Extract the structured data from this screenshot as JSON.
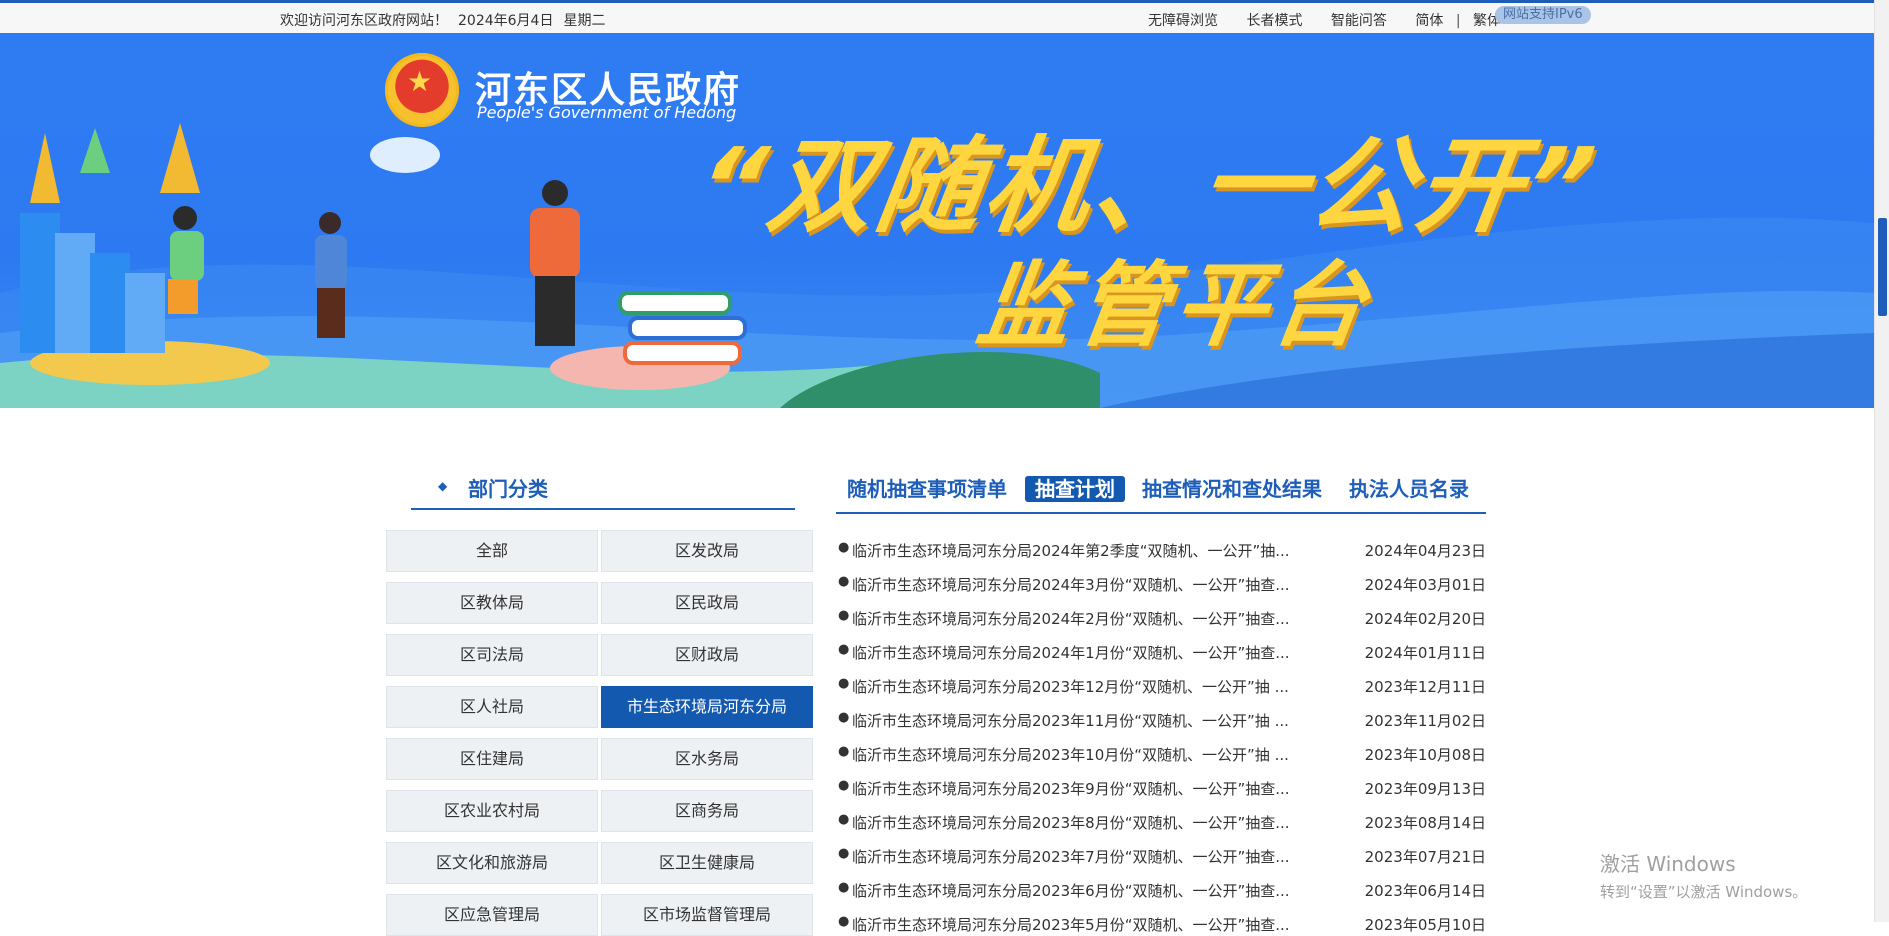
{
  "topbar": {
    "welcome": "欢迎访问河东区政府网站！",
    "date": "2024年6月4日",
    "weekday": "星期二",
    "links": [
      "无障碍浏览",
      "长者模式",
      "智能问答",
      "简体"
    ],
    "sep": "|",
    "traditional": "繁体",
    "ipv6": "网站支持IPv6"
  },
  "banner": {
    "site_name": "河东区人民政府",
    "site_name_en": "People's Government of Hedong",
    "hero_title": "“双随机、一公开”",
    "hero_sub": "监管平台"
  },
  "left": {
    "title": "部门分类",
    "departments": [
      "全部",
      "区发改局",
      "区教体局",
      "区民政局",
      "区司法局",
      "区财政局",
      "区人社局",
      "市生态环境局河东分局",
      "区住建局",
      "区水务局",
      "区农业农村局",
      "区商务局",
      "区文化和旅游局",
      "区卫生健康局",
      "区应急管理局",
      "区市场监督管理局"
    ],
    "active": "市生态环境局河东分局"
  },
  "tabs": [
    "随机抽查事项清单",
    "抽查计划",
    "抽查情况和查处结果",
    "执法人员名录"
  ],
  "active_tab": "抽查计划",
  "news": [
    {
      "title": "临沂市生态环境局河东分局2024年第2季度“双随机、一公开”抽...",
      "date": "2024年04月23日"
    },
    {
      "title": "临沂市生态环境局河东分局2024年3月份“双随机、一公开”抽查...",
      "date": "2024年03月01日"
    },
    {
      "title": "临沂市生态环境局河东分局2024年2月份“双随机、一公开”抽查...",
      "date": "2024年02月20日"
    },
    {
      "title": "临沂市生态环境局河东分局2024年1月份“双随机、一公开”抽查...",
      "date": "2024年01月11日"
    },
    {
      "title": "临沂市生态环境局河东分局2023年12月份“双随机、一公开”抽 ...",
      "date": "2023年12月11日"
    },
    {
      "title": "临沂市生态环境局河东分局2023年11月份“双随机、一公开”抽 ...",
      "date": "2023年11月02日"
    },
    {
      "title": "临沂市生态环境局河东分局2023年10月份“双随机、一公开”抽 ...",
      "date": "2023年10月08日"
    },
    {
      "title": "临沂市生态环境局河东分局2023年9月份“双随机、一公开”抽查...",
      "date": "2023年09月13日"
    },
    {
      "title": "临沂市生态环境局河东分局2023年8月份“双随机、一公开”抽查...",
      "date": "2023年08月14日"
    },
    {
      "title": "临沂市生态环境局河东分局2023年7月份“双随机、一公开”抽查...",
      "date": "2023年07月21日"
    },
    {
      "title": "临沂市生态环境局河东分局2023年6月份“双随机、一公开”抽查...",
      "date": "2023年06月14日"
    },
    {
      "title": "临沂市生态环境局河东分局2023年5月份“双随机、一公开”抽查...",
      "date": "2023年05月10日"
    }
  ],
  "watermark": {
    "line1": "激活 Windows",
    "line2": "转到“设置”以激活 Windows。"
  }
}
